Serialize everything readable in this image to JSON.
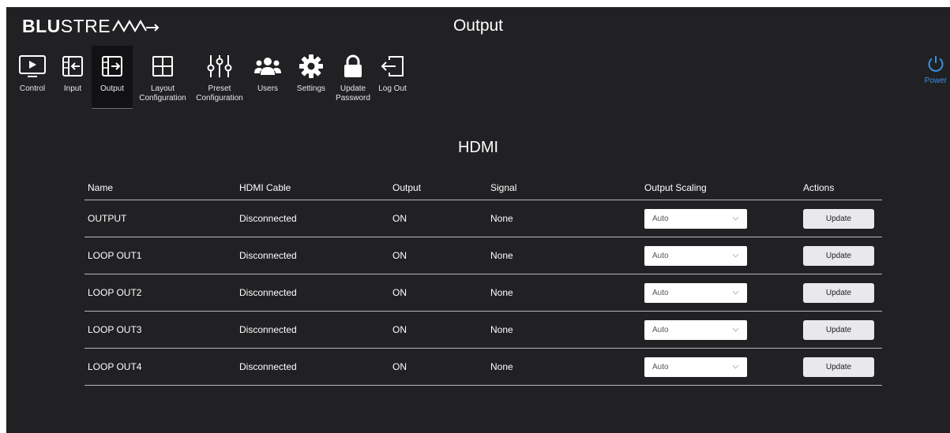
{
  "header": {
    "logo_bold": "BLU",
    "logo_light": "STRE",
    "title": "Output"
  },
  "nav": {
    "items": [
      {
        "label": "Control",
        "icon": "play-icon"
      },
      {
        "label": "Input",
        "icon": "input-icon"
      },
      {
        "label": "Output",
        "icon": "output-icon",
        "active": true
      },
      {
        "label": "Layout\nConfiguration",
        "icon": "layout-grid-icon"
      },
      {
        "label": "Preset\nConfiguration",
        "icon": "sliders-icon"
      },
      {
        "label": "Users",
        "icon": "users-icon"
      },
      {
        "label": "Settings",
        "icon": "gear-icon"
      },
      {
        "label": "Update\nPassword",
        "icon": "lock-icon"
      },
      {
        "label": "Log Out",
        "icon": "logout-icon"
      }
    ],
    "power_label": "Power"
  },
  "section_title": "HDMI",
  "table": {
    "headers": [
      "Name",
      "HDMI Cable",
      "Output",
      "Signal",
      "Output Scaling",
      "Actions"
    ],
    "rows": [
      {
        "name": "OUTPUT",
        "cable": "Disconnected",
        "output": "ON",
        "signal": "None",
        "scaling": "Auto",
        "action": "Update"
      },
      {
        "name": "LOOP OUT1",
        "cable": "Disconnected",
        "output": "ON",
        "signal": "None",
        "scaling": "Auto",
        "action": "Update"
      },
      {
        "name": "LOOP OUT2",
        "cable": "Disconnected",
        "output": "ON",
        "signal": "None",
        "scaling": "Auto",
        "action": "Update"
      },
      {
        "name": "LOOP OUT3",
        "cable": "Disconnected",
        "output": "ON",
        "signal": "None",
        "scaling": "Auto",
        "action": "Update"
      },
      {
        "name": "LOOP OUT4",
        "cable": "Disconnected",
        "output": "ON",
        "signal": "None",
        "scaling": "Auto",
        "action": "Update"
      }
    ]
  },
  "colors": {
    "background": "#212124",
    "accent": "#3d8fe0",
    "button": "#e9e9ed"
  }
}
